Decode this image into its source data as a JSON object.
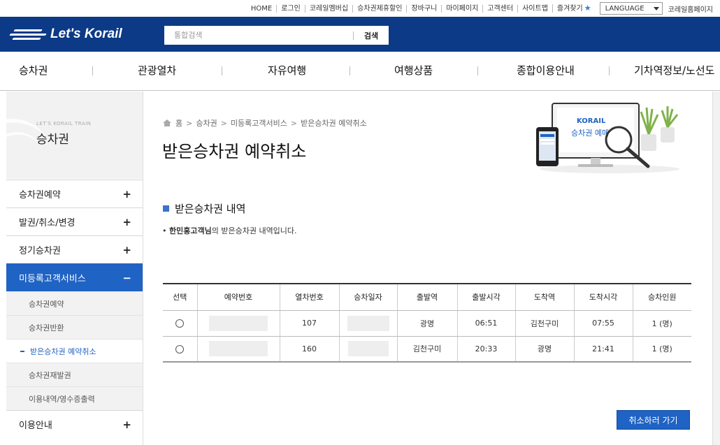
{
  "util": {
    "links": [
      "HOME",
      "로그인",
      "코레일멤버십",
      "승차권제휴할인",
      "장바구니",
      "마이페이지",
      "고객센터",
      "사이트맵",
      "즐겨찾기"
    ],
    "language": "LANGUAGE",
    "homepage": "코레일홈페이지"
  },
  "header": {
    "logo_text": "Let's Korail",
    "search_placeholder": "통합검색",
    "search_button": "검색"
  },
  "gnb": [
    "승차권",
    "관광열차",
    "자유여행",
    "여행상품",
    "종합이용안내",
    "기차역정보/노선도"
  ],
  "sidebar": {
    "subtitle": "LET'S KORAIL TRAIN",
    "title": "승차권",
    "menu": [
      {
        "label": "승차권예약",
        "icon": "+"
      },
      {
        "label": "발권/취소/변경",
        "icon": "+"
      },
      {
        "label": "정기승차권",
        "icon": "+"
      },
      {
        "label": "미등록고객서비스",
        "icon": "−"
      }
    ],
    "submenu": [
      "승차권예약",
      "승차권반환",
      "받은승차권 예약취소",
      "승차권재발권",
      "이용내역/영수증출력"
    ],
    "last_menu": {
      "label": "이용안내",
      "icon": "+"
    }
  },
  "breadcrumb": [
    "홈",
    "승차권",
    "미등록고객서비스",
    "받은승차권 예약취소"
  ],
  "page_title": "받은승차권 예약취소",
  "illustration": {
    "brand": "KORAIL",
    "label": "승차권 예매"
  },
  "section_title": "받은승차권 내역",
  "notice": {
    "name": "한민홍고객님",
    "rest": "의 받은승차권 내역입니다."
  },
  "table": {
    "headers": [
      "선택",
      "예약번호",
      "열차번호",
      "승차일자",
      "출발역",
      "출발시각",
      "도착역",
      "도착시각",
      "승차인원"
    ],
    "rows": [
      {
        "train": "107",
        "dep_station": "광명",
        "dep_time": "06:51",
        "arr_station": "김천구미",
        "arr_time": "07:55",
        "persons": "1 (명)"
      },
      {
        "train": "160",
        "dep_station": "김천구미",
        "dep_time": "20:33",
        "arr_station": "광명",
        "arr_time": "21:41",
        "persons": "1 (명)"
      }
    ]
  },
  "cancel_button": "취소하러 가기",
  "colors": {
    "header_blue": "#0c3a86",
    "accent_blue": "#1f63c4"
  }
}
